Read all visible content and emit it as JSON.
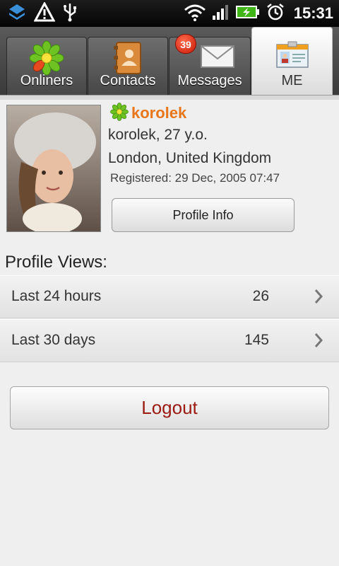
{
  "status_bar": {
    "time": "15:31",
    "icons": [
      "dropbox-sync-icon",
      "warning-icon",
      "usb-icon",
      "wifi-icon",
      "signal-icon",
      "battery-charging-icon",
      "alarm-icon"
    ]
  },
  "tabs": [
    {
      "label": "Onliners",
      "icon": "icq-flower-icon"
    },
    {
      "label": "Contacts",
      "icon": "contacts-book-icon"
    },
    {
      "label": "Messages",
      "icon": "envelope-icon",
      "badge": "39"
    },
    {
      "label": "ME",
      "icon": "id-card-icon",
      "active": true
    }
  ],
  "profile": {
    "username": "korolek",
    "name_age": "korolek, 27 y.o.",
    "location": "London, United Kingdom",
    "registered": "Registered: 29 Dec, 2005 07:47",
    "profile_info_button": "Profile Info"
  },
  "views": {
    "title": "Profile Views:",
    "rows": [
      {
        "label": "Last 24 hours",
        "count": "26"
      },
      {
        "label": "Last 30 days",
        "count": "145"
      }
    ]
  },
  "logout_button": "Logout",
  "colors": {
    "username": "#e8761a",
    "logout_text": "#9b1a12",
    "icq_green": "#5fb31f",
    "badge_red": "#d62510"
  }
}
